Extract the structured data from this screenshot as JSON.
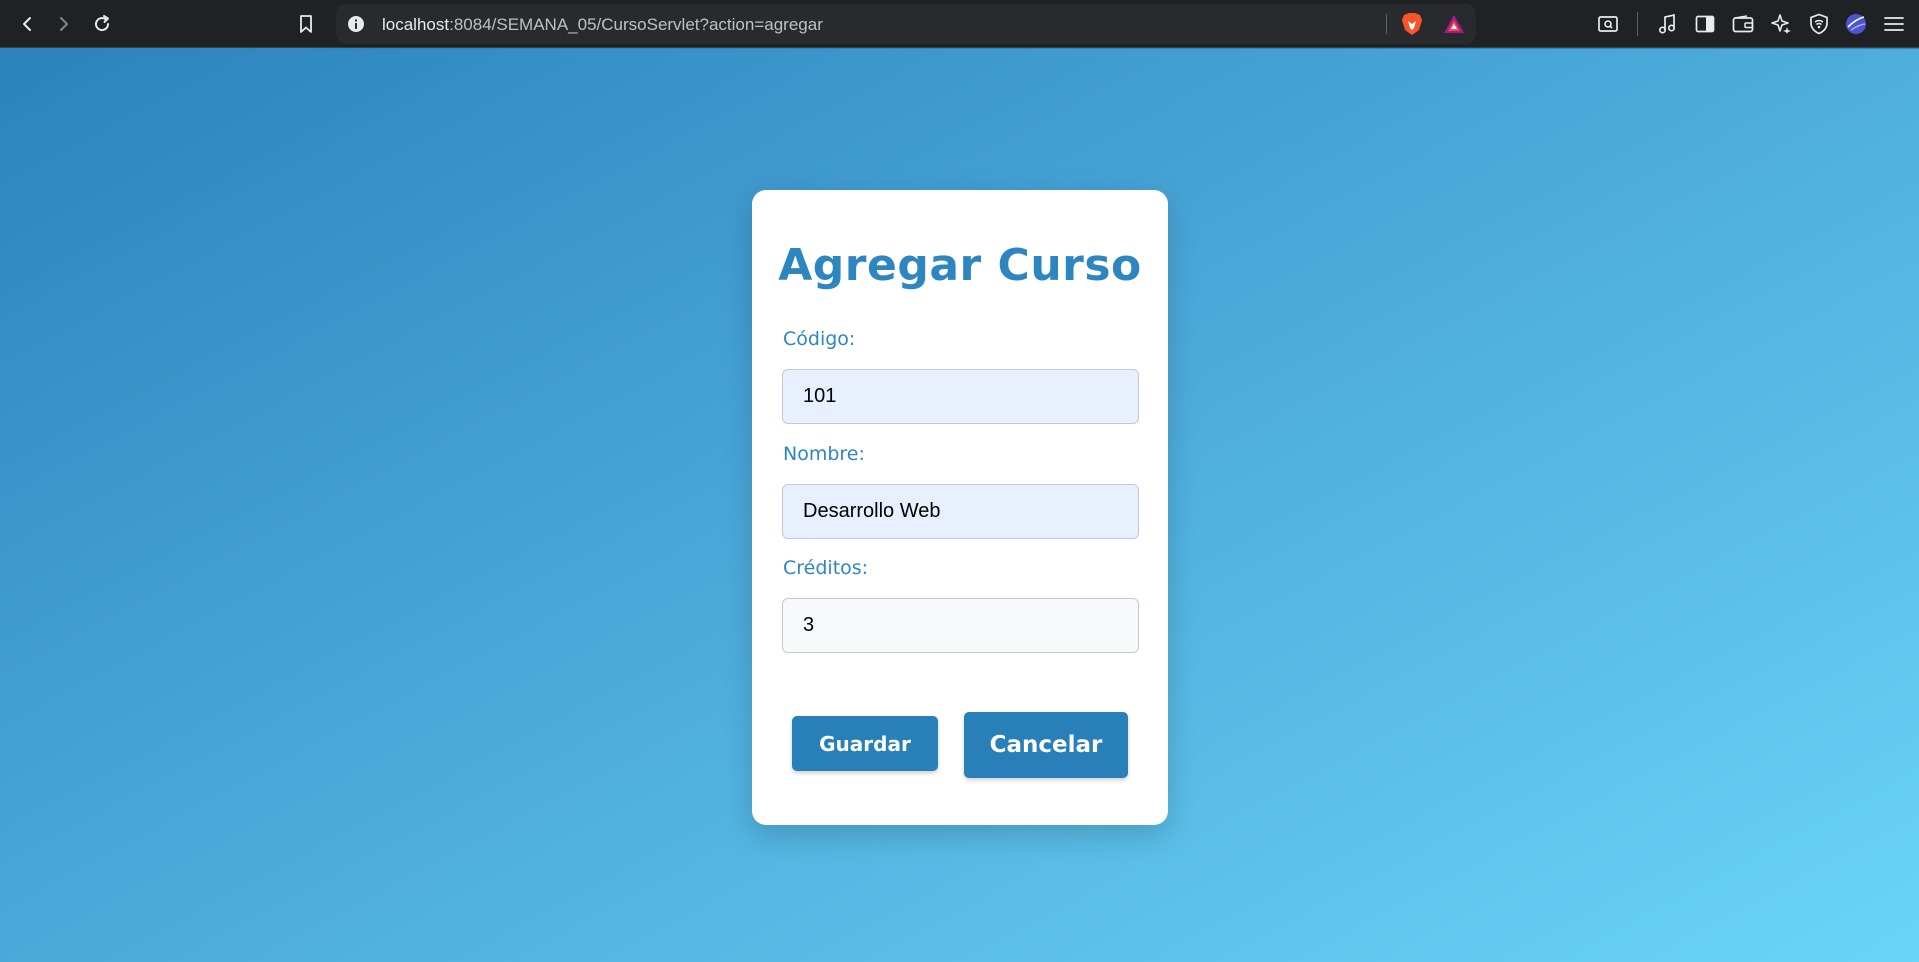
{
  "browser": {
    "url_host": "localhost",
    "url_rest": ":8084/SEMANA_05/CursoServlet?action=agregar",
    "icons": {
      "back": "chevron-left-icon",
      "forward": "chevron-right-icon",
      "reload": "reload-icon",
      "bookmark": "bookmark-icon",
      "site_info": "info-icon",
      "brave_shields": "brave-lion-icon",
      "brave_rewards": "triangle-rewards-icon",
      "screenshot": "screenshot-icon",
      "media": "music-note-icon",
      "sidebar": "sidebar-icon",
      "wallet": "wallet-icon",
      "leo": "sparkle-icon",
      "vpn": "shield-icon",
      "profile": "profile-icon",
      "menu": "hamburger-menu-icon"
    }
  },
  "form": {
    "title": "Agregar Curso",
    "codigo": {
      "label": "Código:",
      "value": "101"
    },
    "nombre": {
      "label": "Nombre:",
      "value": "Desarrollo Web"
    },
    "creditos": {
      "label": "Créditos:",
      "value": "3"
    },
    "save_label": "Guardar",
    "cancel_label": "Cancelar"
  },
  "colors": {
    "accent": "#2e86c1",
    "button": "#2980b9",
    "gradient_start": "#2c82bd",
    "gradient_end": "#6ad5f7"
  }
}
